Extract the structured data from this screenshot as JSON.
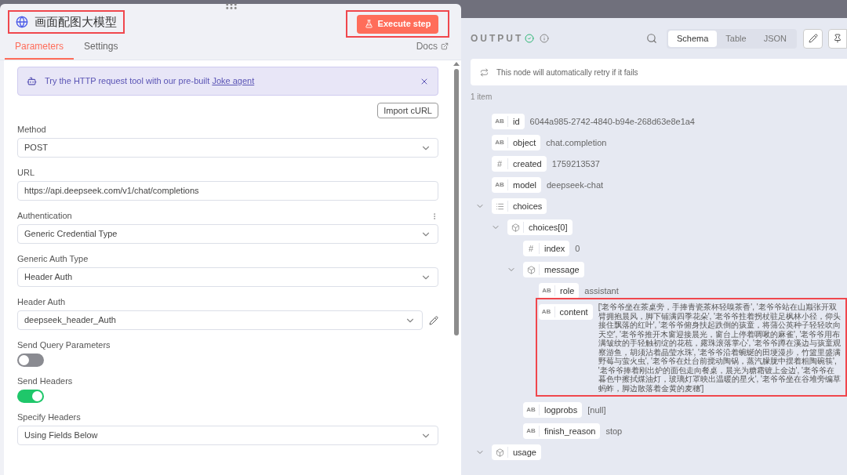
{
  "node": {
    "title": "画面配图大模型",
    "title_highlighted": true,
    "execute_button": "Execute step",
    "execute_highlighted": true,
    "tabs": [
      {
        "label": "Parameters",
        "selected": true
      },
      {
        "label": "Settings",
        "selected": false
      }
    ],
    "docs_link": "Docs",
    "banner": {
      "text": "Try the HTTP request tool with our pre-built ",
      "link": "Joke agent"
    },
    "import_button": "Import cURL",
    "fields": [
      {
        "kind": "select",
        "label": "Method",
        "value": "POST"
      },
      {
        "kind": "input",
        "label": "URL",
        "value": "https://api.deepseek.com/v1/chat/completions"
      },
      {
        "kind": "select",
        "label": "Authentication",
        "value": "Generic Credential Type",
        "has_menu": true
      },
      {
        "kind": "select",
        "label": "Generic Auth Type",
        "value": "Header Auth"
      },
      {
        "kind": "credential",
        "label": "Header Auth",
        "value": "deepseek_header_Auth"
      },
      {
        "kind": "toggle",
        "label": "Send Query Parameters",
        "on": false
      },
      {
        "kind": "toggle",
        "label": "Send Headers",
        "on": true
      },
      {
        "kind": "select",
        "label": "Specify Headers",
        "value": "Using Fields Below"
      }
    ]
  },
  "output": {
    "title": "OUTPUT",
    "views": [
      {
        "label": "Schema",
        "selected": true
      },
      {
        "label": "Table",
        "selected": false
      },
      {
        "label": "JSON",
        "selected": false
      }
    ],
    "notice": "This node will automatically retry if it fails",
    "count": "1 item",
    "tree": [
      {
        "kind": "string",
        "type_glyph": "AB",
        "key": "id",
        "value": "6044a985-2742-4840-b94e-268d63e8e1a4"
      },
      {
        "kind": "string",
        "type_glyph": "AB",
        "key": "object",
        "value": "chat.completion"
      },
      {
        "kind": "number",
        "type_glyph": "#",
        "key": "created",
        "value": "1759213537"
      },
      {
        "kind": "string",
        "type_glyph": "AB",
        "key": "model",
        "value": "deepseek-chat"
      },
      {
        "kind": "array",
        "key": "choices",
        "expanded": true,
        "children": [
          {
            "kind": "object",
            "key": "choices[0]",
            "expanded": true,
            "children": [
              {
                "kind": "number",
                "type_glyph": "#",
                "key": "index",
                "value": "0"
              },
              {
                "kind": "object",
                "key": "message",
                "expanded": true,
                "children": [
                  {
                    "kind": "string",
                    "type_glyph": "AB",
                    "key": "role",
                    "value": "assistant"
                  },
                  {
                    "kind": "string",
                    "type_glyph": "AB",
                    "key": "content",
                    "highlighted": true,
                    "value": "['老爷爷坐在茶桌旁，手捧青瓷茶杯轻嗅茶香', '老爷爷站在山巅张开双臂拥抱晨风，脚下铺满四季花朵', '老爷爷拄着拐杖驻足枫林小径，仰头接住飘落的红叶', '老爷爷俯身扶起跌倒的孩童，将蒲公英种子轻轻吹向天空', '老爷爷推开木窗迎接晨光，窗台上停着啁啾的麻雀', '老爷爷用布满皱纹的手轻触初绽的花苞，露珠滚落掌心', '老爷爷蹲在溪边与孩童观察游鱼，胡须沾着晶莹水珠', '老爷爷沿着蜿蜒的田埂漫步，竹篮里盛满野莓与萤火虫', '老爷爷在灶台前搅动陶锅，蒸汽朦胧中摆着粗陶碗筷', '老爷爷捧着刚出炉的面包走向餐桌，晨光为糖霜镀上金边', '老爷爷在暮色中擦拭煤油灯，玻璃灯罩映出温暖的星火', '老爷爷坐在谷堆旁编草蚂蚱，脚边散落着金黄的麦穗']"
                  }
                ]
              },
              {
                "kind": "string",
                "type_glyph": "AB",
                "key": "logprobs",
                "value": "[null]"
              },
              {
                "kind": "string",
                "type_glyph": "AB",
                "key": "finish_reason",
                "value": "stop"
              }
            ]
          }
        ]
      },
      {
        "kind": "object",
        "key": "usage",
        "expanded": true
      }
    ]
  }
}
